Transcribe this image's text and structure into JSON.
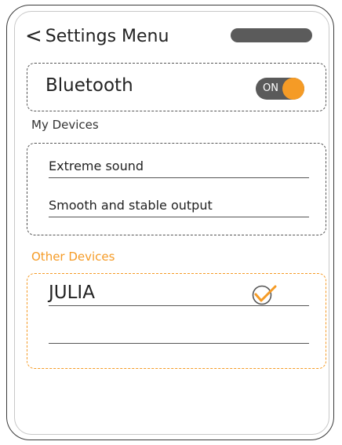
{
  "header": {
    "title": "Settings Menu",
    "back_icon": "chevron-left-icon"
  },
  "bluetooth": {
    "label": "Bluetooth",
    "toggle_text": "ON",
    "enabled": true,
    "accent": "#f59b26"
  },
  "my_devices": {
    "label": "My Devices",
    "items": [
      {
        "name": "Extreme sound"
      },
      {
        "name": "Smooth and stable output"
      }
    ]
  },
  "other_devices": {
    "label": "Other Devices",
    "items": [
      {
        "name": "JULIA",
        "selected": true,
        "icon": "check-circle-icon"
      },
      {
        "name": ""
      }
    ]
  },
  "colors": {
    "accent": "#f59b26",
    "dark": "#5a5a5a",
    "text": "#222222"
  }
}
